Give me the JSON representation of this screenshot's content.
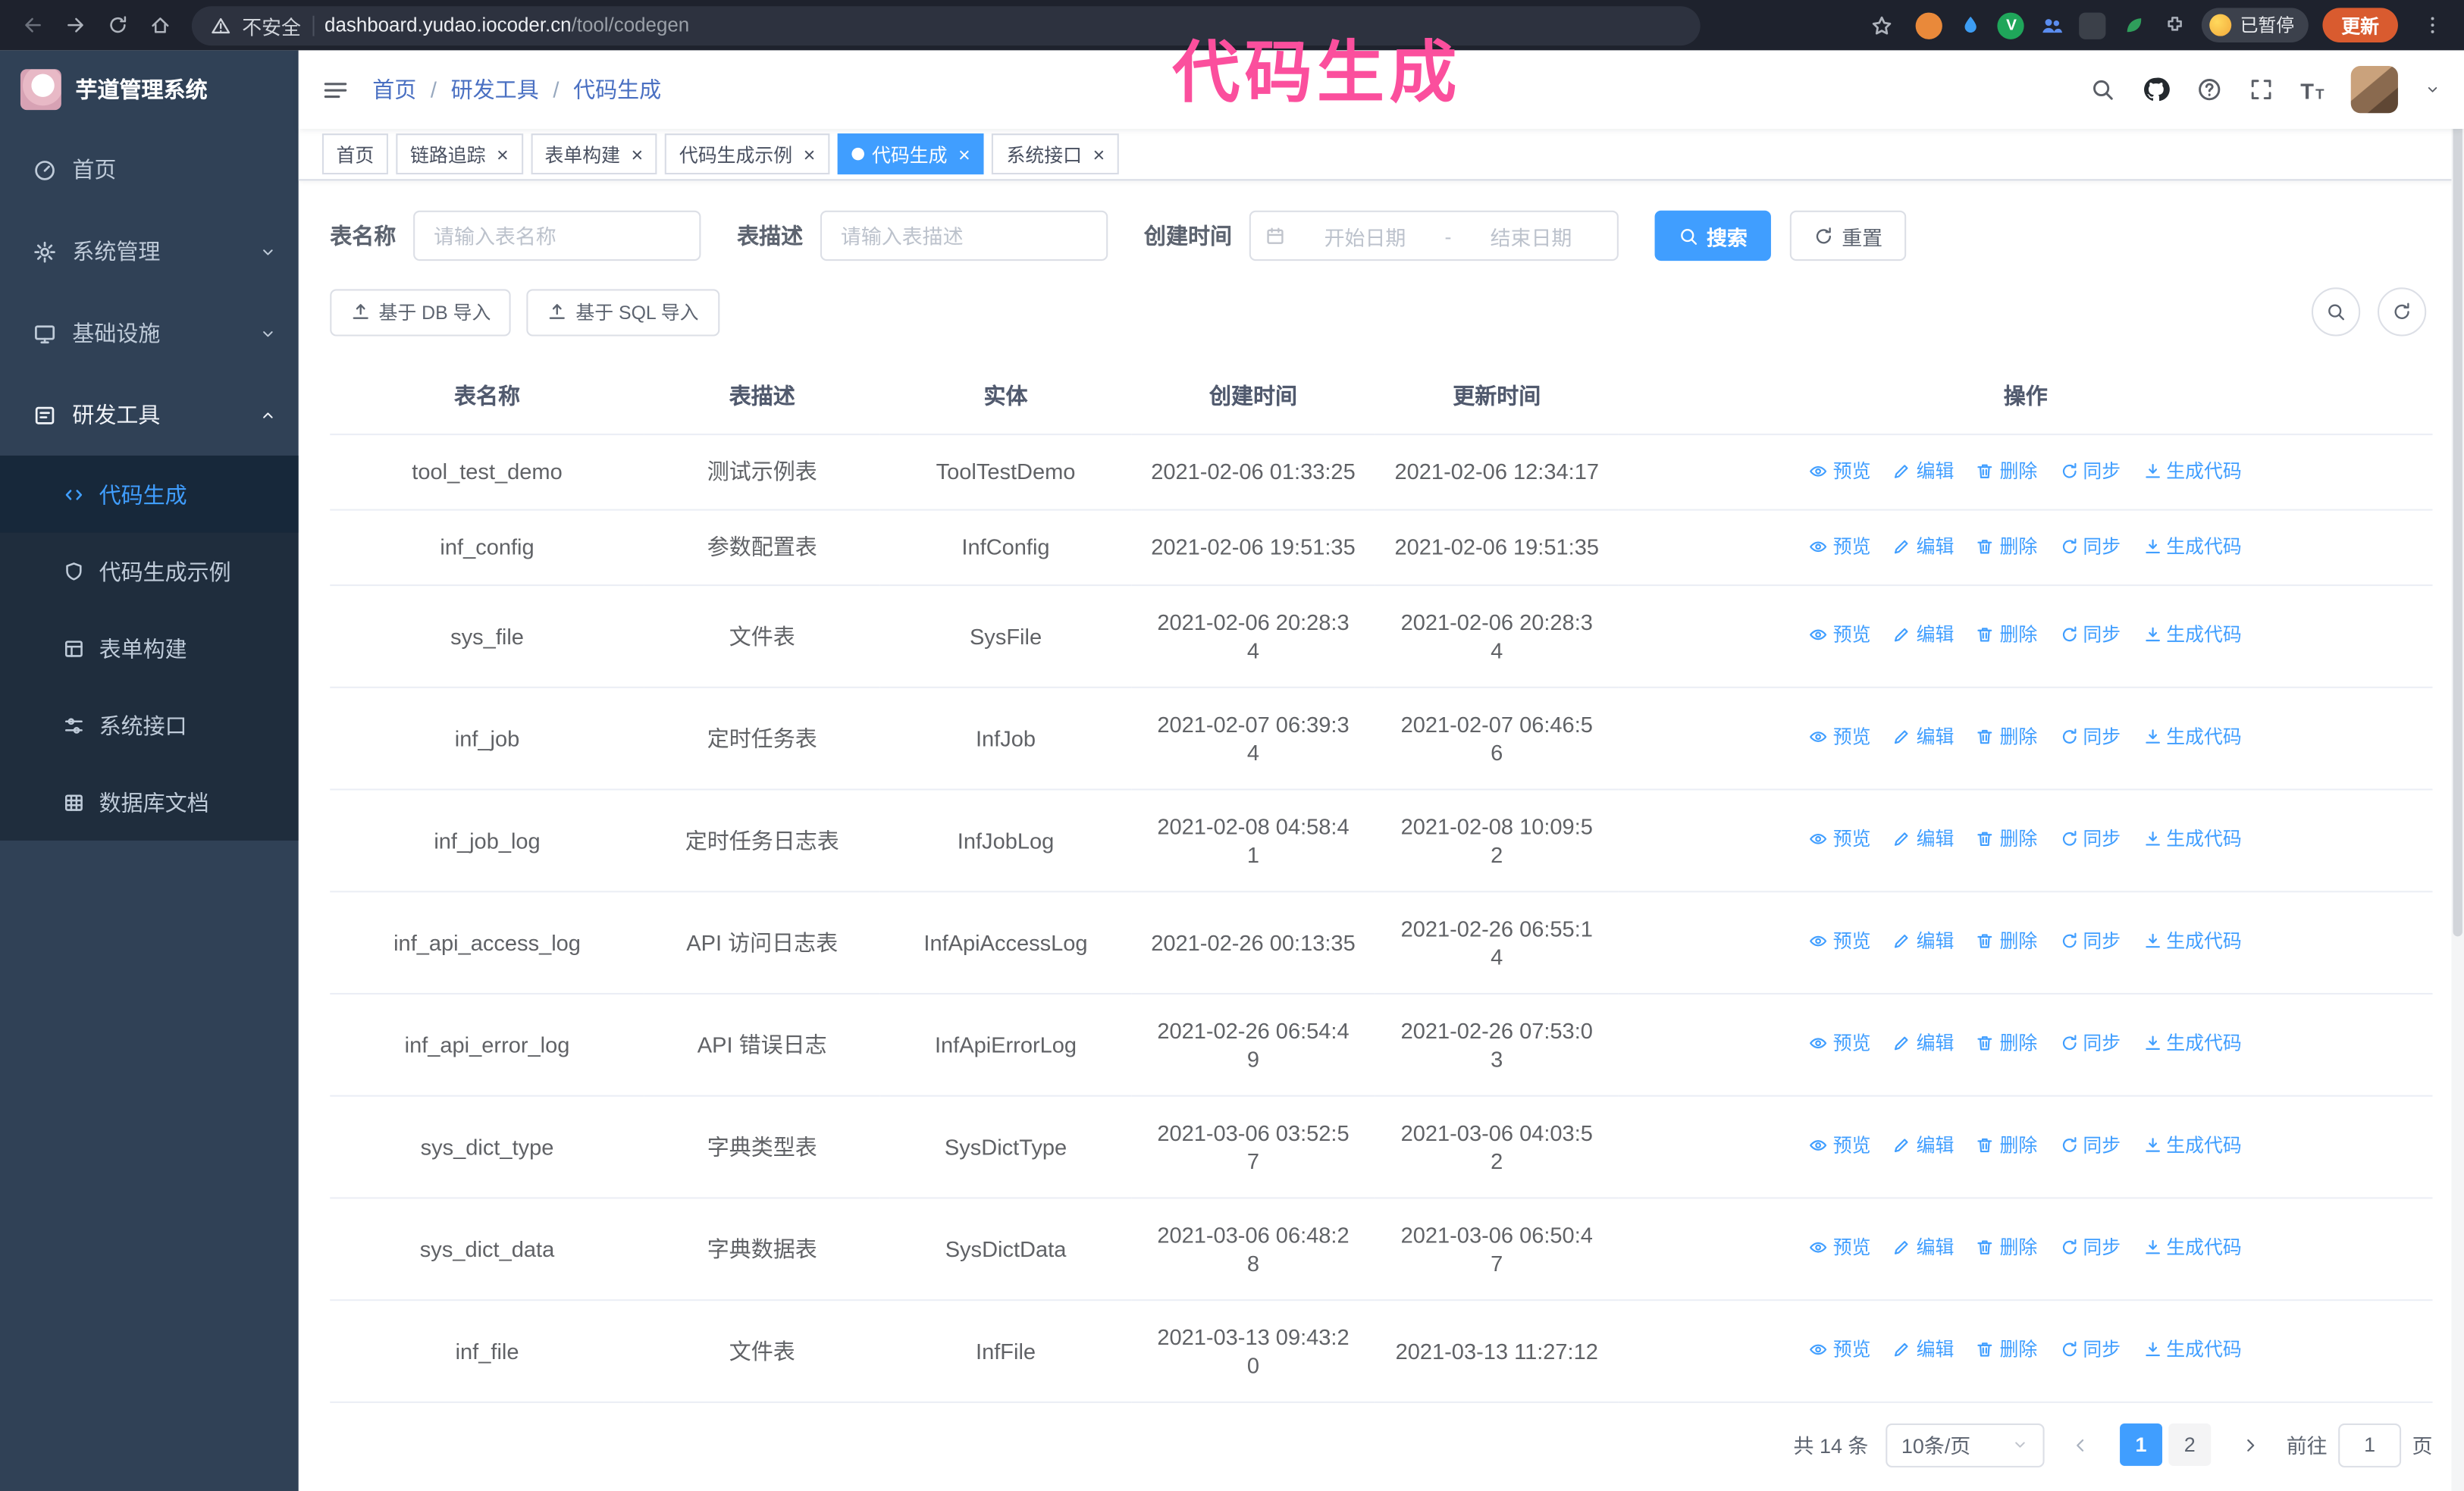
{
  "browser": {
    "security_label": "不安全",
    "url_host": "dashboard.yudao.iocoder.cn",
    "url_path": "/tool/codegen",
    "paused_badge": "已暂停",
    "update_label": "更新"
  },
  "annotation": {
    "text": "代码生成",
    "color": "#fb4f9d"
  },
  "colors": {
    "accent": "#409eff",
    "sidebar_bg": "#304156",
    "submenu_bg": "#1f2d3d",
    "annotation_pink": "#fb4f9d",
    "update_button_bg": "#d95b2f"
  },
  "sidebar": {
    "title": "芋道管理系统",
    "items": [
      {
        "label": "首页",
        "icon": "dashboard-icon"
      },
      {
        "label": "系统管理",
        "icon": "gear-icon",
        "chevron": "down"
      },
      {
        "label": "基础设施",
        "icon": "monitor-icon",
        "chevron": "down"
      },
      {
        "label": "研发工具",
        "icon": "tools-icon",
        "chevron": "up",
        "expanded": true,
        "children": [
          {
            "label": "代码生成",
            "icon": "code-icon",
            "active": true
          },
          {
            "label": "代码生成示例",
            "icon": "shield-icon"
          },
          {
            "label": "表单构建",
            "icon": "form-icon"
          },
          {
            "label": "系统接口",
            "icon": "sliders-icon"
          },
          {
            "label": "数据库文档",
            "icon": "grid-icon"
          }
        ]
      }
    ]
  },
  "header": {
    "breadcrumb": [
      "首页",
      "研发工具",
      "代码生成"
    ],
    "separator": "/"
  },
  "tabs": [
    {
      "label": "首页",
      "closable": false,
      "active": false
    },
    {
      "label": "链路追踪",
      "closable": true,
      "active": false
    },
    {
      "label": "表单构建",
      "closable": true,
      "active": false
    },
    {
      "label": "代码生成示例",
      "closable": true,
      "active": false
    },
    {
      "label": "代码生成",
      "closable": true,
      "active": true
    },
    {
      "label": "系统接口",
      "closable": true,
      "active": false
    }
  ],
  "filters": {
    "table_name_label": "表名称",
    "table_name_placeholder": "请输入表名称",
    "table_desc_label": "表描述",
    "table_desc_placeholder": "请输入表描述",
    "create_time_label": "创建时间",
    "start_placeholder": "开始日期",
    "range_separator": "-",
    "end_placeholder": "结束日期",
    "search_label": "搜索",
    "reset_label": "重置"
  },
  "toolbar": {
    "import_db_label": "基于 DB 导入",
    "import_sql_label": "基于 SQL 导入"
  },
  "table": {
    "columns": [
      "表名称",
      "表描述",
      "实体",
      "创建时间",
      "更新时间",
      "操作"
    ],
    "actions": [
      {
        "label": "预览",
        "icon": "eye-icon"
      },
      {
        "label": "编辑",
        "icon": "edit-icon"
      },
      {
        "label": "删除",
        "icon": "trash-icon"
      },
      {
        "label": "同步",
        "icon": "sync-icon"
      },
      {
        "label": "生成代码",
        "icon": "download-icon"
      }
    ],
    "rows": [
      {
        "name": "tool_test_demo",
        "description": "测试示例表",
        "entity": "ToolTestDemo",
        "create_time": "2021-02-06 01:33:25",
        "update_time": "2021-02-06 12:34:17"
      },
      {
        "name": "inf_config",
        "description": "参数配置表",
        "entity": "InfConfig",
        "create_time": "2021-02-06 19:51:35",
        "update_time": "2021-02-06 19:51:35"
      },
      {
        "name": "sys_file",
        "description": "文件表",
        "entity": "SysFile",
        "create_time": "2021-02-06 20:28:3\n4",
        "update_time": "2021-02-06 20:28:3\n4"
      },
      {
        "name": "inf_job",
        "description": "定时任务表",
        "entity": "InfJob",
        "create_time": "2021-02-07 06:39:3\n4",
        "update_time": "2021-02-07 06:46:5\n6"
      },
      {
        "name": "inf_job_log",
        "description": "定时任务日志表",
        "entity": "InfJobLog",
        "create_time": "2021-02-08 04:58:4\n1",
        "update_time": "2021-02-08 10:09:5\n2"
      },
      {
        "name": "inf_api_access_log",
        "description": "API 访问日志表",
        "entity": "InfApiAccessLog",
        "create_time": "2021-02-26 00:13:35",
        "update_time": "2021-02-26 06:55:1\n4"
      },
      {
        "name": "inf_api_error_log",
        "description": "API 错误日志",
        "entity": "InfApiErrorLog",
        "create_time": "2021-02-26 06:54:4\n9",
        "update_time": "2021-02-26 07:53:0\n3"
      },
      {
        "name": "sys_dict_type",
        "description": "字典类型表",
        "entity": "SysDictType",
        "create_time": "2021-03-06 03:52:5\n7",
        "update_time": "2021-03-06 04:03:5\n2"
      },
      {
        "name": "sys_dict_data",
        "description": "字典数据表",
        "entity": "SysDictData",
        "create_time": "2021-03-06 06:48:2\n8",
        "update_time": "2021-03-06 06:50:4\n7"
      },
      {
        "name": "inf_file",
        "description": "文件表",
        "entity": "InfFile",
        "create_time": "2021-03-13 09:43:2\n0",
        "update_time": "2021-03-13 11:27:12"
      }
    ]
  },
  "pagination": {
    "total_label": "共 14 条",
    "page_size_label": "10条/页",
    "pages": [
      "1",
      "2"
    ],
    "active_page": "1",
    "goto_label": "前往",
    "goto_value": "1",
    "goto_unit": "页"
  }
}
